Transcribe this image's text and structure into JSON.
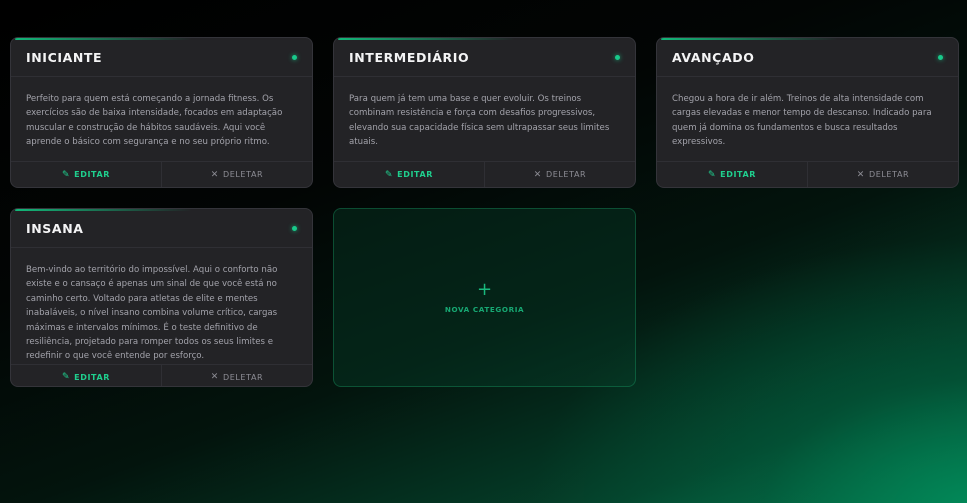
{
  "categories": [
    {
      "title": "INICIANTE",
      "description": "Perfeito para quem está começando a jornada fitness. Os exercícios são de baixa intensidade, focados em adaptação muscular e construção de hábitos saudáveis. Aqui você aprende o básico com segurança e no seu próprio ritmo.",
      "edit_label": "EDITAR",
      "delete_label": "DELETAR"
    },
    {
      "title": "INTERMEDIÁRIO",
      "description": "Para quem já tem uma base e quer evoluir. Os treinos combinam resistência e força com desafios progressivos, elevando sua capacidade física sem ultrapassar seus limites atuais.",
      "edit_label": "EDITAR",
      "delete_label": "DELETAR"
    },
    {
      "title": "AVANÇADO",
      "description": "Chegou a hora de ir além. Treinos de alta intensidade com cargas elevadas e menor tempo de descanso. Indicado para quem já domina os fundamentos e busca resultados expressivos.",
      "edit_label": "EDITAR",
      "delete_label": "DELETAR"
    },
    {
      "title": "INSANA",
      "description": "Bem-vindo ao território do impossível. Aqui o conforto não existe e o cansaço é apenas um sinal de que você está no caminho certo. Voltado para atletas de elite e mentes inabaláveis, o nível insano combina volume crítico, cargas máximas e intervalos mínimos. É o teste definitivo de resiliência, projetado para romper todos os seus limites e redefinir o que você entende por esforço.",
      "edit_label": "EDITAR",
      "delete_label": "DELETAR"
    }
  ],
  "new_category": {
    "plus": "+",
    "label": "NOVA CATEGORIA"
  },
  "icons": {
    "edit": "pencil-icon",
    "delete": "close-icon",
    "status": "status-dot"
  },
  "colors": {
    "accent": "#18c98a",
    "card_bg": "#232326",
    "text_muted": "#a3a3ab"
  }
}
